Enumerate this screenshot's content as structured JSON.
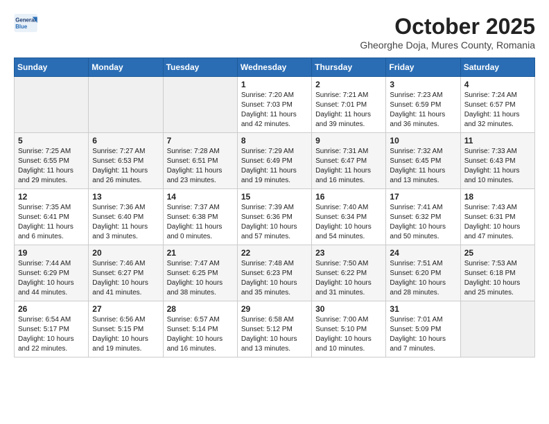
{
  "logo": {
    "line1": "General",
    "line2": "Blue"
  },
  "title": "October 2025",
  "subtitle": "Gheorghe Doja, Mures County, Romania",
  "days_of_week": [
    "Sunday",
    "Monday",
    "Tuesday",
    "Wednesday",
    "Thursday",
    "Friday",
    "Saturday"
  ],
  "weeks": [
    [
      {
        "day": "",
        "info": ""
      },
      {
        "day": "",
        "info": ""
      },
      {
        "day": "",
        "info": ""
      },
      {
        "day": "1",
        "info": "Sunrise: 7:20 AM\nSunset: 7:03 PM\nDaylight: 11 hours\nand 42 minutes."
      },
      {
        "day": "2",
        "info": "Sunrise: 7:21 AM\nSunset: 7:01 PM\nDaylight: 11 hours\nand 39 minutes."
      },
      {
        "day": "3",
        "info": "Sunrise: 7:23 AM\nSunset: 6:59 PM\nDaylight: 11 hours\nand 36 minutes."
      },
      {
        "day": "4",
        "info": "Sunrise: 7:24 AM\nSunset: 6:57 PM\nDaylight: 11 hours\nand 32 minutes."
      }
    ],
    [
      {
        "day": "5",
        "info": "Sunrise: 7:25 AM\nSunset: 6:55 PM\nDaylight: 11 hours\nand 29 minutes."
      },
      {
        "day": "6",
        "info": "Sunrise: 7:27 AM\nSunset: 6:53 PM\nDaylight: 11 hours\nand 26 minutes."
      },
      {
        "day": "7",
        "info": "Sunrise: 7:28 AM\nSunset: 6:51 PM\nDaylight: 11 hours\nand 23 minutes."
      },
      {
        "day": "8",
        "info": "Sunrise: 7:29 AM\nSunset: 6:49 PM\nDaylight: 11 hours\nand 19 minutes."
      },
      {
        "day": "9",
        "info": "Sunrise: 7:31 AM\nSunset: 6:47 PM\nDaylight: 11 hours\nand 16 minutes."
      },
      {
        "day": "10",
        "info": "Sunrise: 7:32 AM\nSunset: 6:45 PM\nDaylight: 11 hours\nand 13 minutes."
      },
      {
        "day": "11",
        "info": "Sunrise: 7:33 AM\nSunset: 6:43 PM\nDaylight: 11 hours\nand 10 minutes."
      }
    ],
    [
      {
        "day": "12",
        "info": "Sunrise: 7:35 AM\nSunset: 6:41 PM\nDaylight: 11 hours\nand 6 minutes."
      },
      {
        "day": "13",
        "info": "Sunrise: 7:36 AM\nSunset: 6:40 PM\nDaylight: 11 hours\nand 3 minutes."
      },
      {
        "day": "14",
        "info": "Sunrise: 7:37 AM\nSunset: 6:38 PM\nDaylight: 11 hours\nand 0 minutes."
      },
      {
        "day": "15",
        "info": "Sunrise: 7:39 AM\nSunset: 6:36 PM\nDaylight: 10 hours\nand 57 minutes."
      },
      {
        "day": "16",
        "info": "Sunrise: 7:40 AM\nSunset: 6:34 PM\nDaylight: 10 hours\nand 54 minutes."
      },
      {
        "day": "17",
        "info": "Sunrise: 7:41 AM\nSunset: 6:32 PM\nDaylight: 10 hours\nand 50 minutes."
      },
      {
        "day": "18",
        "info": "Sunrise: 7:43 AM\nSunset: 6:31 PM\nDaylight: 10 hours\nand 47 minutes."
      }
    ],
    [
      {
        "day": "19",
        "info": "Sunrise: 7:44 AM\nSunset: 6:29 PM\nDaylight: 10 hours\nand 44 minutes."
      },
      {
        "day": "20",
        "info": "Sunrise: 7:46 AM\nSunset: 6:27 PM\nDaylight: 10 hours\nand 41 minutes."
      },
      {
        "day": "21",
        "info": "Sunrise: 7:47 AM\nSunset: 6:25 PM\nDaylight: 10 hours\nand 38 minutes."
      },
      {
        "day": "22",
        "info": "Sunrise: 7:48 AM\nSunset: 6:23 PM\nDaylight: 10 hours\nand 35 minutes."
      },
      {
        "day": "23",
        "info": "Sunrise: 7:50 AM\nSunset: 6:22 PM\nDaylight: 10 hours\nand 31 minutes."
      },
      {
        "day": "24",
        "info": "Sunrise: 7:51 AM\nSunset: 6:20 PM\nDaylight: 10 hours\nand 28 minutes."
      },
      {
        "day": "25",
        "info": "Sunrise: 7:53 AM\nSunset: 6:18 PM\nDaylight: 10 hours\nand 25 minutes."
      }
    ],
    [
      {
        "day": "26",
        "info": "Sunrise: 6:54 AM\nSunset: 5:17 PM\nDaylight: 10 hours\nand 22 minutes."
      },
      {
        "day": "27",
        "info": "Sunrise: 6:56 AM\nSunset: 5:15 PM\nDaylight: 10 hours\nand 19 minutes."
      },
      {
        "day": "28",
        "info": "Sunrise: 6:57 AM\nSunset: 5:14 PM\nDaylight: 10 hours\nand 16 minutes."
      },
      {
        "day": "29",
        "info": "Sunrise: 6:58 AM\nSunset: 5:12 PM\nDaylight: 10 hours\nand 13 minutes."
      },
      {
        "day": "30",
        "info": "Sunrise: 7:00 AM\nSunset: 5:10 PM\nDaylight: 10 hours\nand 10 minutes."
      },
      {
        "day": "31",
        "info": "Sunrise: 7:01 AM\nSunset: 5:09 PM\nDaylight: 10 hours\nand 7 minutes."
      },
      {
        "day": "",
        "info": ""
      }
    ]
  ]
}
